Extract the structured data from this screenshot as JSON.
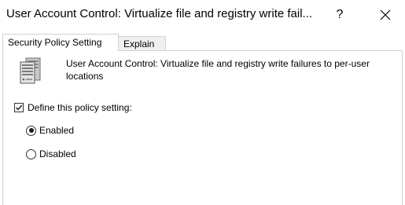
{
  "window": {
    "title": "User Account Control: Virtualize file and registry write fail...",
    "help_label": "?",
    "close_label": "✕"
  },
  "tabs": [
    {
      "label": "Security Policy Setting",
      "active": true
    },
    {
      "label": "Explain",
      "active": false
    }
  ],
  "policy": {
    "icon": "policy-server-icon",
    "name": "User Account Control: Virtualize file and registry write failures to per-user locations"
  },
  "define_setting": {
    "label": "Define this policy setting:",
    "checked": true
  },
  "options": [
    {
      "label": "Enabled",
      "selected": true
    },
    {
      "label": "Disabled",
      "selected": false
    }
  ]
}
